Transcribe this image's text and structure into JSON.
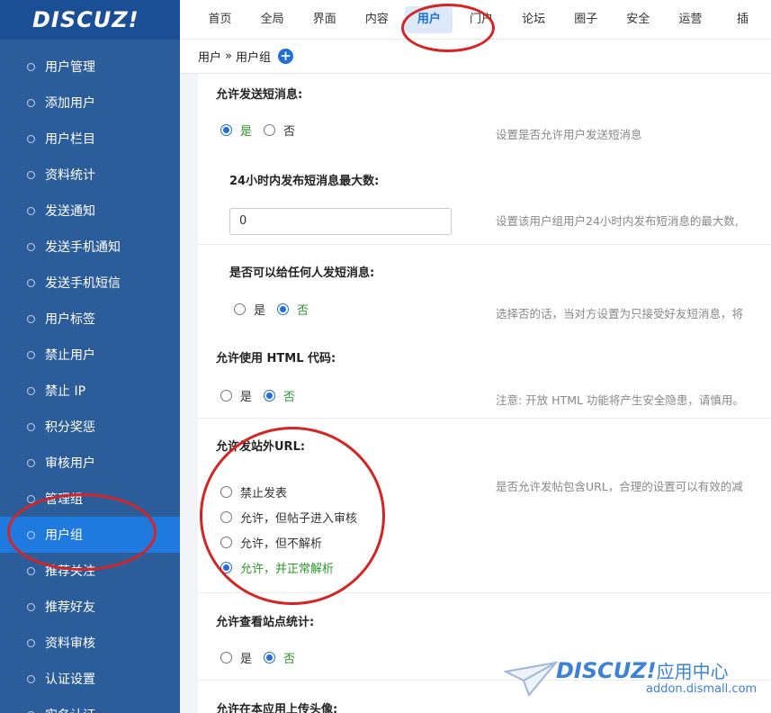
{
  "logo": "DISCUZ!",
  "topnav": [
    "首页",
    "全局",
    "界面",
    "内容",
    "用户",
    "门户",
    "论坛",
    "圈子",
    "安全",
    "运营",
    "插"
  ],
  "breadcrumb": {
    "parent": "用户",
    "sep": "»",
    "current": "用户组",
    "add_icon": "plus-circle-icon"
  },
  "sidebar": [
    "用户管理",
    "添加用户",
    "用户栏目",
    "资料统计",
    "发送通知",
    "发送手机通知",
    "发送手机短信",
    "用户标签",
    "禁止用户",
    "禁止 IP",
    "积分奖惩",
    "审核用户",
    "管理组",
    "用户组",
    "推荐关注",
    "推荐好友",
    "资料审核",
    "认证设置",
    "实名认证"
  ],
  "active_sidebar": "用户组",
  "active_tab": "用户",
  "settings": {
    "send_pm": {
      "title": "允许发送短消息:",
      "yes": "是",
      "no": "否",
      "selected": "是",
      "desc": "设置是否允许用户发送短消息"
    },
    "pm_limit": {
      "title": "24小时内发布短消息最大数:",
      "value": "0",
      "desc": "设置该用户组用户24小时内发布短消息的最大数,"
    },
    "pm_anyone": {
      "title": "是否可以给任何人发短消息:",
      "yes": "是",
      "no": "否",
      "selected": "否",
      "desc": "选择否的话，当对方设置为只接受好友短消息，将"
    },
    "html_code": {
      "title": "允许使用 HTML 代码:",
      "yes": "是",
      "no": "否",
      "selected": "否",
      "desc": "注意: 开放 HTML 功能将产生安全隐患，请慎用。"
    },
    "post_url": {
      "title": "允许发站外URL:",
      "options": [
        "禁止发表",
        "允许，但帖子进入审核",
        "允许，但不解析",
        "允许，并正常解析"
      ],
      "selected": "允许，并正常解析",
      "desc": "是否允许发帖包含URL，合理的设置可以有效的减"
    },
    "view_stats": {
      "title": "允许查看站点统计:",
      "yes": "是",
      "no": "否",
      "selected": "否"
    },
    "upload_avatar": {
      "title": "允许在本应用上传头像:"
    }
  },
  "watermark": {
    "brand": "DISCUZ!",
    "brand_cn": "应用中心",
    "site": "addon.dismall.com"
  },
  "colors": {
    "sidebar": "#2b5d9b",
    "sidebar_active": "#1f7ae0",
    "accent": "#1f6fd6",
    "selected_text": "#2b9a2b",
    "annotation": "#d42424"
  }
}
